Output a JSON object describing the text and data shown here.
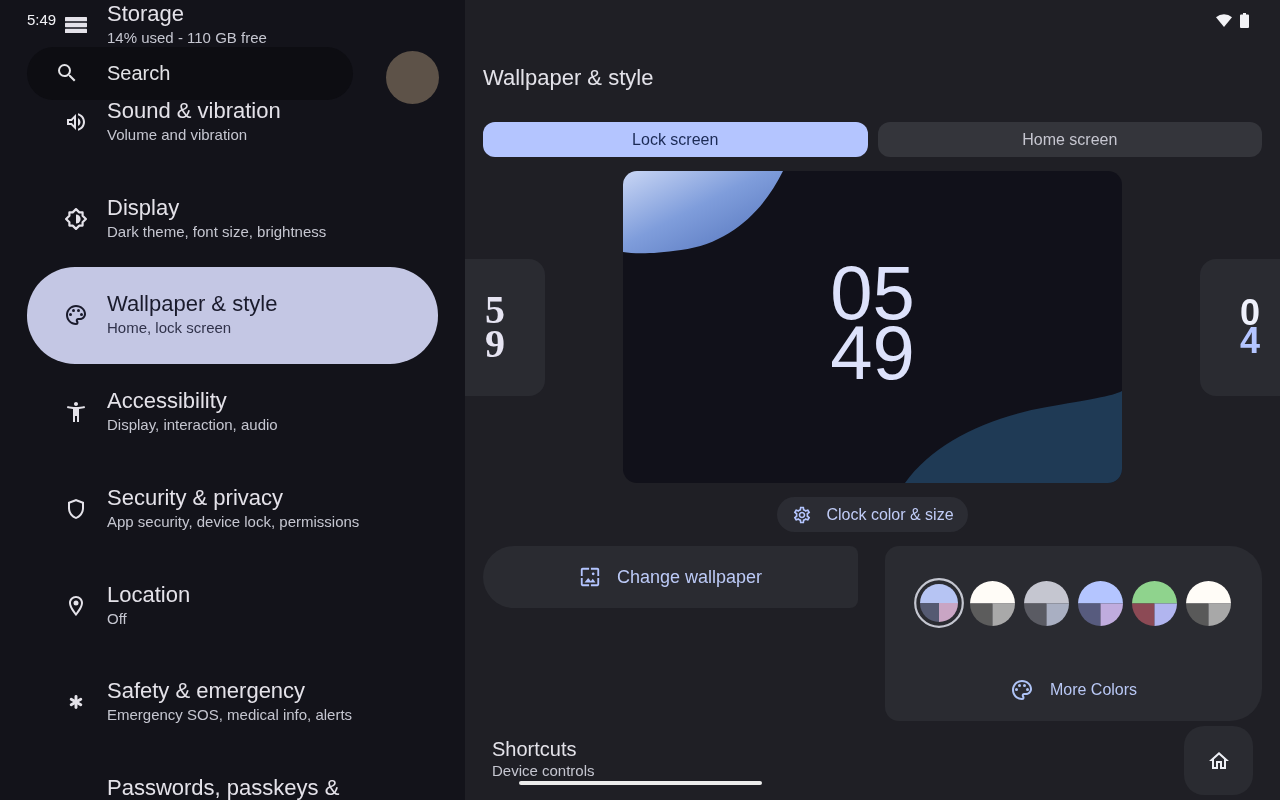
{
  "status_bar": {
    "time": "5:49"
  },
  "search": {
    "placeholder": "Search"
  },
  "settings": [
    {
      "title": "Storage",
      "subtitle": "14% used - 110 GB free",
      "selected": false
    },
    {
      "title": "Sound & vibration",
      "subtitle": "Volume and vibration",
      "selected": false
    },
    {
      "title": "Display",
      "subtitle": "Dark theme, font size, brightness",
      "selected": false
    },
    {
      "title": "Wallpaper & style",
      "subtitle": "Home, lock screen",
      "selected": true
    },
    {
      "title": "Accessibility",
      "subtitle": "Display, interaction, audio",
      "selected": false
    },
    {
      "title": "Security & privacy",
      "subtitle": "App security, device lock, permissions",
      "selected": false
    },
    {
      "title": "Location",
      "subtitle": "Off",
      "selected": false
    },
    {
      "title": "Safety & emergency",
      "subtitle": "Emergency SOS, medical info, alerts",
      "selected": false
    },
    {
      "title": "Passwords, passkeys &",
      "selected": false
    }
  ],
  "page": {
    "title": "Wallpaper & style"
  },
  "tabs": [
    {
      "label": "Lock screen",
      "selected": true
    },
    {
      "label": "Home screen",
      "selected": false
    }
  ],
  "clock_preview": {
    "hour": "05",
    "minute": "49"
  },
  "clock_styles": [
    {
      "lines": [
        "5",
        "9"
      ]
    },
    {
      "lines": [
        "0",
        "4"
      ]
    }
  ],
  "clock_button": {
    "label": "Clock color & size"
  },
  "change_wallpaper_button": {
    "label": "Change wallpaper"
  },
  "color_options": [
    {
      "selected": true,
      "segments": [
        {
          "color": "#b6c4f3"
        },
        {
          "color": "#555a72"
        },
        {
          "color": "#c9a5c4"
        }
      ]
    },
    {
      "selected": false,
      "segments": [
        {
          "color": "#fffcf7"
        },
        {
          "color": "#5c5c5c"
        },
        {
          "color": "#a9a9a9"
        }
      ]
    },
    {
      "selected": false,
      "segments": [
        {
          "color": "#c5c6d0"
        },
        {
          "color": "#5a5b63"
        },
        {
          "color": "#a9afc2"
        }
      ]
    },
    {
      "selected": false,
      "segments": [
        {
          "color": "#b4c5ff"
        },
        {
          "color": "#575b7e"
        },
        {
          "color": "#c0acde"
        }
      ]
    },
    {
      "selected": false,
      "segments": [
        {
          "color": "#8fd38d"
        },
        {
          "color": "#8c4a55"
        },
        {
          "color": "#b1b5ef"
        }
      ]
    },
    {
      "selected": false,
      "segments": [
        {
          "color": "#fffcf7"
        },
        {
          "color": "#595959"
        },
        {
          "color": "#a8a8a8"
        }
      ]
    }
  ],
  "more_colors_button": {
    "label": "More Colors"
  },
  "shortcuts": {
    "title": "Shortcuts",
    "subtitle": "Device controls"
  }
}
